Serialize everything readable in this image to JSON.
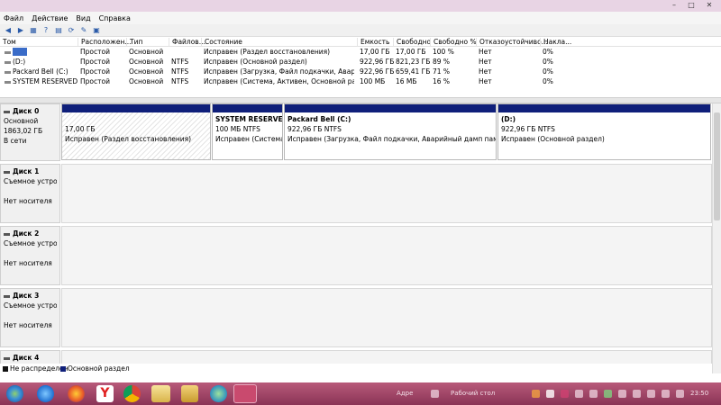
{
  "menu": [
    "Файл",
    "Действие",
    "Вид",
    "Справка"
  ],
  "volume_table": {
    "columns": [
      "Том",
      "Расположен...",
      "Тип",
      "Файлов...",
      "Состояние",
      "Емкость",
      "Свободно",
      "Свободно %",
      "Отказоустойчиво...",
      "Накла..."
    ],
    "rows": [
      {
        "name": "",
        "layout": "Простой",
        "type": "Основной",
        "fs": "",
        "status": "Исправен (Раздел восстановления)",
        "capacity": "17,00 ГБ",
        "free": "17,00 ГБ",
        "free_pct": "100 %",
        "fault": "Нет",
        "overhead": "0%"
      },
      {
        "name": "(D:)",
        "layout": "Простой",
        "type": "Основной",
        "fs": "NTFS",
        "status": "Исправен (Основной раздел)",
        "capacity": "922,96 ГБ",
        "free": "821,23 ГБ",
        "free_pct": "89 %",
        "fault": "Нет",
        "overhead": "0%"
      },
      {
        "name": "Packard Bell (C:)",
        "layout": "Простой",
        "type": "Основной",
        "fs": "NTFS",
        "status": "Исправен (Загрузка, Файл подкачки, Аварийный дамп памяти, Основной раздел)",
        "capacity": "922,96 ГБ",
        "free": "659,41 ГБ",
        "free_pct": "71 %",
        "fault": "Нет",
        "overhead": "0%"
      },
      {
        "name": "SYSTEM RESERVED",
        "layout": "Простой",
        "type": "Основной",
        "fs": "NTFS",
        "status": "Исправен (Система, Активен, Основной раздел)",
        "capacity": "100 МБ",
        "free": "16 МБ",
        "free_pct": "16 %",
        "fault": "Нет",
        "overhead": "0%"
      }
    ]
  },
  "disks": [
    {
      "name": "Диск 0",
      "type": "Основной",
      "size": "1863,02 ГБ",
      "state": "В сети",
      "partitions": [
        {
          "title": "",
          "size": "17,00 ГБ",
          "status": "Исправен (Раздел восстановления)"
        },
        {
          "title": "SYSTEM RESERVED",
          "size": "100 МБ NTFS",
          "status": "Исправен (Система, Активен, Основной раздел)"
        },
        {
          "title": "Packard Bell  (C:)",
          "size": "922,96 ГБ NTFS",
          "status": "Исправен (Загрузка, Файл подкачки, Аварийный дамп памяти, Основной раздел)"
        },
        {
          "title": "(D:)",
          "size": "922,96 ГБ NTFS",
          "status": "Исправен (Основной раздел)"
        }
      ]
    },
    {
      "name": "Диск 1",
      "type": "Съемное устройство",
      "state": "Нет носителя"
    },
    {
      "name": "Диск 2",
      "type": "Съемное устройство",
      "state": "Нет носителя"
    },
    {
      "name": "Диск 3",
      "type": "Съемное устройство",
      "state": "Нет носителя"
    },
    {
      "name": "Диск 4"
    }
  ],
  "legend": {
    "unallocated": "Не распределен",
    "primary": "Основной раздел"
  },
  "taskbar": {
    "apps": [
      "start-orb",
      "internet-explorer",
      "firefox",
      "yandex-browser",
      "chrome",
      "file-explorer",
      "media-player",
      "maps",
      "disk-management"
    ],
    "tray_left": "Адре",
    "tray_mid": "Рабочий стол",
    "time": "23:50"
  },
  "colors": {
    "partition_bar": "#0f1f7a",
    "selection": "#3a6cc8",
    "taskbar": "#8a3456"
  }
}
